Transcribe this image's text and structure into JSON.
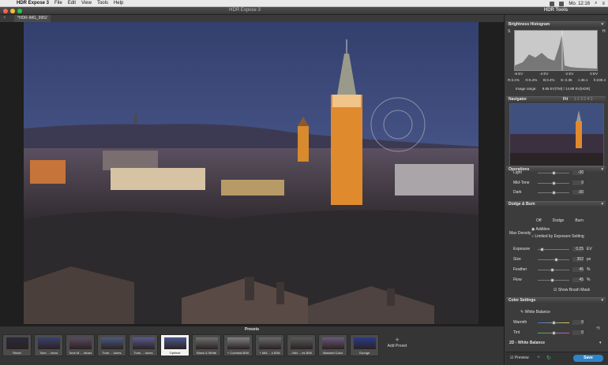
{
  "menubar": {
    "app_name": "HDR Expose 3",
    "items": [
      "File",
      "Edit",
      "View",
      "Tools",
      "Help"
    ],
    "clock": "Mo. 12:16"
  },
  "window": {
    "title": "HDR Expose 3",
    "tools_title": "HDR Tools",
    "doc_tab": "*HDR-IMG_9952"
  },
  "histogram": {
    "title": "Brightness Histogram",
    "corner_left": "S",
    "corner_right": "H",
    "ev_labels": [
      "-6 EV",
      "-4 EV",
      "-2 EV",
      "0 EV"
    ],
    "stats": [
      "R:3.1%",
      "G:5.4%",
      "B:3.4%",
      "S:-2.35",
      "c:46.1",
      "h:230.4"
    ],
    "range_label": "Image range:",
    "range_value": "9.65 EV(TM) / 14.88 EV(HDR)"
  },
  "navigator": {
    "title": "Navigator",
    "fit_label": "Fit",
    "zoom_labels": "1:1 2:1 4:1"
  },
  "operations": {
    "title": "Operations",
    "rows": [
      {
        "label": "Light",
        "value": "-30"
      },
      {
        "label": "Mid-Tone",
        "value": "0"
      },
      {
        "label": "Dark",
        "value": "-30"
      }
    ]
  },
  "dodge_burn": {
    "title": "Dodge & Burn",
    "modes": [
      "Off",
      "Dodge",
      "Burn"
    ],
    "max_density_label": "Max Density",
    "option_additive": "Additive",
    "option_limited": "Limited by Exposure Setting",
    "rows": [
      {
        "label": "Exposure",
        "value": "0.25",
        "unit": "EV"
      },
      {
        "label": "Size",
        "value": "302",
        "unit": "px"
      },
      {
        "label": "Feather",
        "value": "45",
        "unit": "%"
      },
      {
        "label": "Flow",
        "value": "45",
        "unit": "%"
      }
    ],
    "show_mask": "Show Brush Mask"
  },
  "color_settings": {
    "title": "Color Settings",
    "white_balance": "White Balance",
    "rows": [
      {
        "label": "Warmth",
        "value": "0"
      },
      {
        "label": "Tint",
        "value": "0"
      }
    ],
    "section_2d": "2D - White Balance"
  },
  "footer": {
    "preview_label": "Preview",
    "save_label": "Save"
  },
  "presets": {
    "title": "Presets",
    "add_label": "Add Preset",
    "items": [
      {
        "name": "Reset",
        "selected": false
      },
      {
        "name": "Tone ... inear",
        "selected": false
      },
      {
        "name": "Tone M ... ntrast",
        "selected": false
      },
      {
        "name": "Tone ... tones",
        "selected": false
      },
      {
        "name": "Tone ... tones",
        "selected": false
      },
      {
        "name": "Optimal",
        "selected": true
      },
      {
        "name": "Black & White",
        "selected": false
      },
      {
        "name": "+ Contrast B/W",
        "selected": false
      },
      {
        "name": "+ Mid ... s B/W",
        "selected": false
      },
      {
        "name": "- Mid ... es B/W",
        "selected": false
      },
      {
        "name": "Washed Color",
        "selected": false
      },
      {
        "name": "Grunge",
        "selected": false
      }
    ]
  },
  "colors": {
    "accent": "#2f84c7",
    "sky_top": "#3a4a7a",
    "tower": "#e08a2e"
  }
}
